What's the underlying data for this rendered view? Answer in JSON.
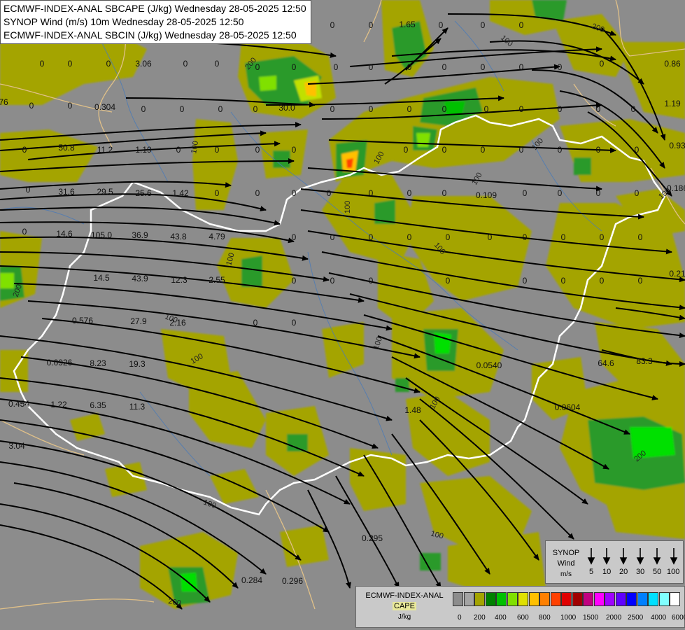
{
  "header": {
    "line1": "ECMWF-INDEX-ANAL SBCAPE (J/kg) Wednesday 28-05-2025 12:50",
    "line2": "SYNOP Wind (m/s) 10m Wednesday 28-05-2025 12:50",
    "line3": "ECMWF-INDEX-ANAL SBCIN (J/kg) Wednesday 28-05-2025 12:50"
  },
  "colors": {
    "background": "#8c8c8c",
    "low_cape": "#a4a400",
    "mid_cape": "#2a9a2a",
    "green_bright": "#00e000",
    "border": "#ffffff",
    "province_lines": "#e0c088",
    "rivers": "#4a7ab8",
    "streamlines": "#000000"
  },
  "map_values": [
    "0",
    "0",
    "0",
    "0",
    "0",
    "0",
    "0",
    "0",
    "0",
    "0",
    "0",
    "0",
    "0",
    "0",
    "0",
    "0",
    "0",
    "0",
    "0",
    "0",
    "0",
    "0",
    "0",
    "0",
    "0",
    "0",
    "0",
    "0",
    "0",
    "0",
    "0",
    "0",
    "0",
    "0",
    "0",
    "0",
    "0",
    "0",
    "0",
    "0",
    "0",
    "0",
    "0",
    "0",
    "0",
    "0",
    "0",
    "0",
    "0",
    "0",
    "0",
    "0",
    "0",
    "0",
    "0",
    "0",
    "0",
    "0",
    "0",
    "0",
    "3.06",
    "0.304",
    "76",
    "50.8",
    "11.2",
    "1.19",
    "31.6",
    "29.5",
    "25.6",
    "1.42",
    "14.6",
    "105.0",
    "36.9",
    "43.8",
    "4.79",
    "14.5",
    "43.9",
    "12.3",
    "2.55",
    "0.576",
    "27.9",
    "2.16",
    "0.0926",
    "8.23",
    "19.3",
    "0.454",
    "1.22",
    "6.35",
    "11.3",
    "3.04",
    "1.48",
    "0.0540",
    "64.6",
    "83.3",
    "0.0604",
    "0.109",
    "0.295",
    "0.284",
    "0.296",
    "1.19",
    "1.65",
    "0.186",
    "0.93",
    "0.86",
    "0.21",
    "30.0",
    "0",
    "0",
    "0",
    "0",
    "0",
    "0",
    "0",
    "0",
    "0",
    "0",
    "0",
    "0",
    "0",
    "0",
    "0",
    "0",
    "0",
    "0",
    "0",
    "0"
  ],
  "contours": [
    "200",
    "100",
    "100",
    "100",
    "100",
    "100",
    "200",
    "100",
    "200",
    "100",
    "100",
    "100",
    "100",
    "100",
    "100",
    "200",
    "200",
    "100",
    "100",
    "100"
  ],
  "synop_legend": {
    "label": [
      "SYNOP",
      "Wind",
      "m/s"
    ],
    "speeds": [
      "5",
      "10",
      "20",
      "30",
      "50",
      "100"
    ]
  },
  "cape_scale": {
    "label": [
      "ECMWF-INDEX-ANAL",
      "CAPE",
      "J/kg"
    ],
    "colors": [
      "#8c8c8c",
      "#a4a4a4",
      "#a4a400",
      "#008000",
      "#00c000",
      "#80e000",
      "#e0e000",
      "#ffc000",
      "#ff8000",
      "#ff4000",
      "#e00000",
      "#a00000",
      "#c00080",
      "#ff00ff",
      "#a000ff",
      "#6000ff",
      "#0000ff",
      "#0080ff",
      "#00e0ff",
      "#80ffff",
      "#ffffff"
    ],
    "ticks": [
      "0",
      "200",
      "400",
      "600",
      "800",
      "1000",
      "1500",
      "2000",
      "2500",
      "4000",
      "6000"
    ]
  }
}
